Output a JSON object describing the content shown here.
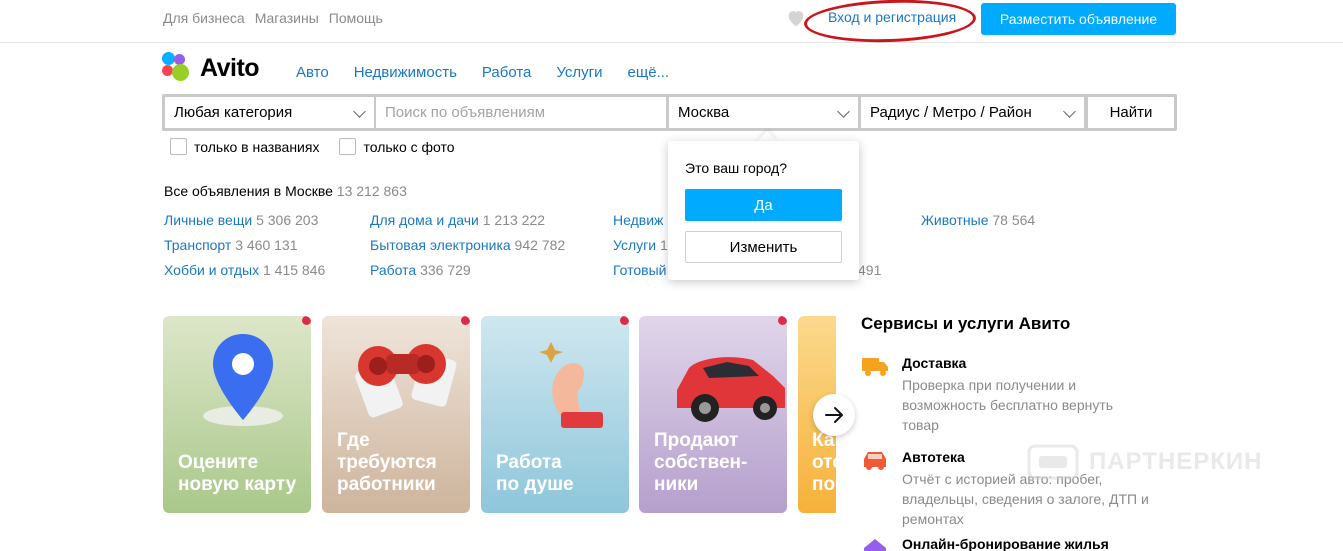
{
  "topbar": {
    "links": [
      "Для бизнеса",
      "Магазины",
      "Помощь"
    ],
    "login": "Вход и регистрация",
    "post_ad": "Разместить объявление"
  },
  "logo": {
    "text": "Avito"
  },
  "nav": [
    "Авто",
    "Недвижимость",
    "Работа",
    "Услуги",
    "ещё..."
  ],
  "search": {
    "category": "Любая категория",
    "query_placeholder": "Поиск по объявлениям",
    "city": "Москва",
    "radius": "Радиус / Метро / Район",
    "find": "Найти",
    "only_titles": "только в названиях",
    "only_photo": "только с фото"
  },
  "all_ads": {
    "label": "Все объявления в Москве",
    "count": "13 212 863"
  },
  "categories": [
    {
      "name": "Личные вещи",
      "count": "5 306 203"
    },
    {
      "name": "Транспорт",
      "count": "3 460 131"
    },
    {
      "name": "Хобби и отдых",
      "count": "1 415 846"
    },
    {
      "name": "Для дома и дачи",
      "count": "1 213 222"
    },
    {
      "name": "Бытовая электроника",
      "count": "942 782"
    },
    {
      "name": "Работа",
      "count": "336 729"
    },
    {
      "name": "Недвиж",
      "count": ""
    },
    {
      "name": "Услуги",
      "count": "1"
    },
    {
      "name": "Готовый",
      "count": ""
    },
    {
      "name": "Животные",
      "count": "78 564"
    },
    {
      "name": "",
      "count": "491"
    }
  ],
  "city_popup": {
    "question": "Это ваш город?",
    "yes": "Да",
    "change": "Изменить"
  },
  "cards": [
    {
      "title": "Оцените\nновую карту"
    },
    {
      "title": "Где\nтребуются\nработники"
    },
    {
      "title": "Работа\nпо душе"
    },
    {
      "title": "Продают\nсобствен-\nники"
    },
    {
      "title": "Ка\nотс\nпо"
    }
  ],
  "services": {
    "title": "Сервисы и услуги Авито",
    "items": [
      {
        "name": "Доставка",
        "desc": "Проверка при получении и возможность бесплатно вернуть товар"
      },
      {
        "name": "Автотека",
        "desc": "Отчёт с историей авто: пробег, владельцы, сведения о залоге, ДТП и ремонтах"
      },
      {
        "name": "Онлайн-бронирование жилья",
        "desc": ""
      }
    ]
  },
  "watermark": "ПАРТНЕРКИН",
  "colors": {
    "accent": "#00aaff",
    "link": "#1a78c2",
    "annotation": "#c8161d"
  }
}
